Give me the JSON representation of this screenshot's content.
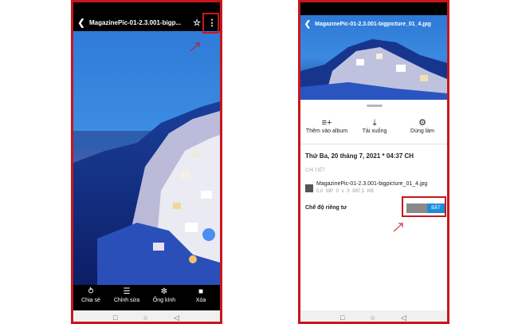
{
  "screen1": {
    "title": "MagazinePic-01-2.3.001-bigp...",
    "bottom_actions": [
      {
        "label": "Chia sẻ",
        "icon": "share-icon"
      },
      {
        "label": "Chỉnh sửa",
        "icon": "edit-sliders-icon"
      },
      {
        "label": "Ống kính",
        "icon": "lens-icon"
      },
      {
        "label": "Xóa",
        "icon": "trash-icon"
      }
    ]
  },
  "screen2": {
    "title": "MagazinePic-01-2.3.001-bigpicture_01_4.jpg",
    "actions": [
      {
        "label": "Thêm vào album",
        "icon": "add-to-playlist-icon"
      },
      {
        "label": "Tải xuống",
        "icon": "download-icon"
      },
      {
        "label": "Dùng làm",
        "icon": "gear-icon"
      }
    ],
    "date": "Thứ Ba, 20 tháng 7, 2021 * 04:37 CH",
    "details_header": "CHI TIẾT",
    "file_name": "MagazinePic-01-2.3.001-bigpicture_01_4.jpg",
    "file_meta": "0,0 MP  0 x 0  897,1 KB",
    "privacy_label": "Chế độ riêng tư",
    "toggle_label": "BẬT"
  },
  "colors": {
    "highlight_border": "#c8161d",
    "toggle_on": "#1a8fd7",
    "toggle_off": "#8a8a8a"
  }
}
